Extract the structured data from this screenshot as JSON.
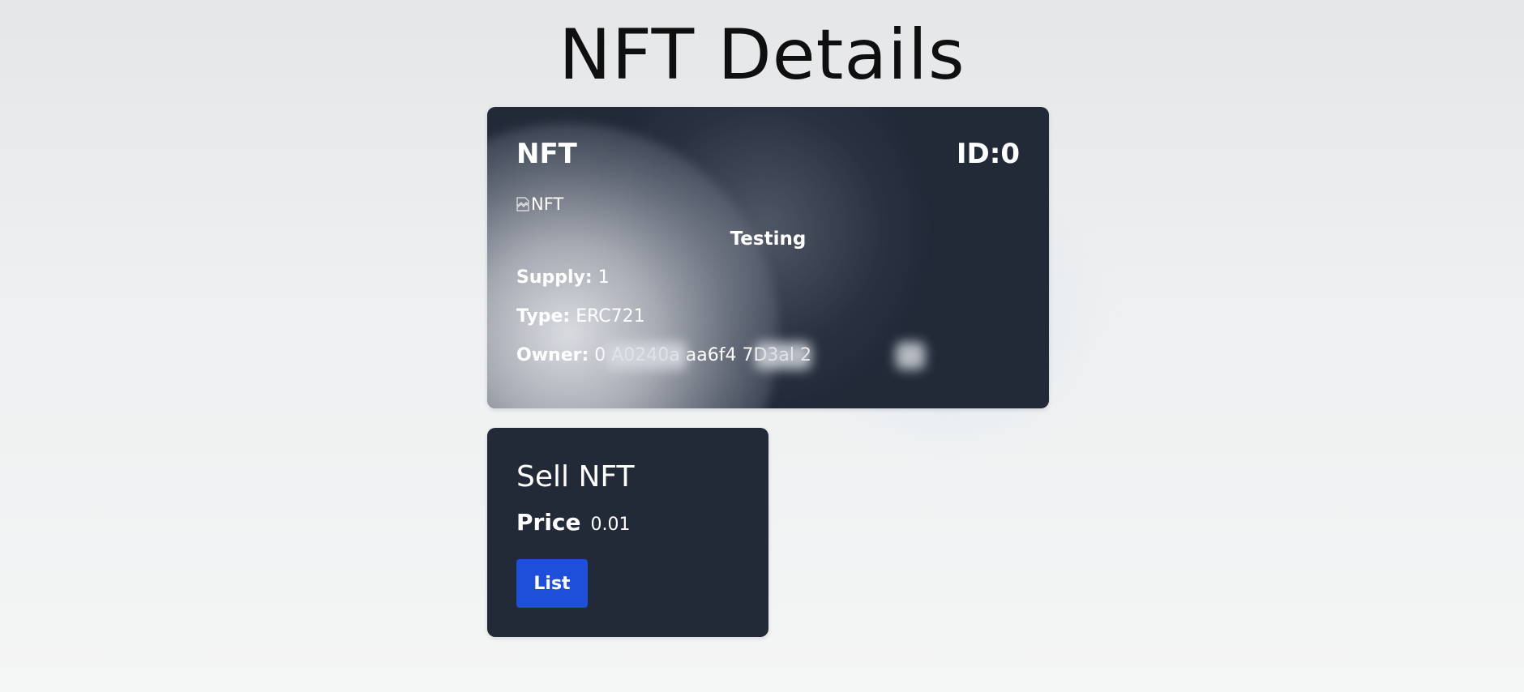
{
  "page": {
    "title": "NFT Details"
  },
  "nft": {
    "label": "NFT",
    "id_text": "ID:0",
    "image_alt": "NFT",
    "name": "Testing",
    "supply_label": "Supply:",
    "supply_value": "1",
    "type_label": "Type:",
    "type_value": "ERC721",
    "owner_label": "Owner:",
    "owner_value_visible": "0 A0240a aa6f4 7D3al 2"
  },
  "sell": {
    "title": "Sell NFT",
    "price_label": "Price",
    "price_value": "0.01",
    "list_label": "List"
  },
  "colors": {
    "card_bg": "#222a38",
    "button_bg": "#1e4fd8",
    "text_light": "#ffffff",
    "title_dark": "#0f0f10"
  },
  "icons": {
    "image_placeholder": "broken-image-icon"
  }
}
